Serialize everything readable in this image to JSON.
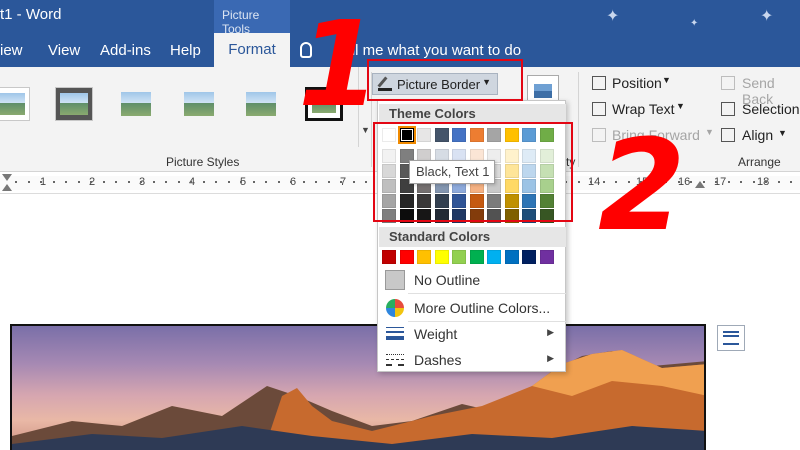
{
  "titlebar": {
    "doc_title": "t1 - Word",
    "context_tab": "Picture Tools"
  },
  "menu": {
    "view": "iew",
    "view2": "View",
    "addins": "Add-ins",
    "help": "Help",
    "format": "Format",
    "tellme": "Tell me what you want to do"
  },
  "ribbon": {
    "picture_styles_label": "Picture Styles",
    "picture_border_label": "Picture Border",
    "arrange_label": "Arrange",
    "position": "Position",
    "wrap_text": "Wrap Text",
    "bring_forward": "Bring Forward",
    "send_back": "Send Back",
    "selection": "Selection",
    "align": "Align",
    "size_fragment": "ty"
  },
  "ruler": {
    "numbers_left": [
      "1",
      "1",
      "2",
      "3",
      "4",
      "5",
      "6",
      "7",
      "8"
    ],
    "numbers_right": [
      "14",
      "15",
      "16",
      "17",
      "18"
    ]
  },
  "dropdown": {
    "theme_colors_header": "Theme Colors",
    "standard_colors_header": "Standard Colors",
    "tooltip": "Black, Text 1",
    "no_outline": "No Outline",
    "more_outline_colors": "More Outline Colors...",
    "weight": "Weight",
    "dashes": "Dashes",
    "theme_top_row": [
      "#ffffff",
      "#000000",
      "#e7e6e6",
      "#44546a",
      "#4472c4",
      "#ed7d31",
      "#a5a5a5",
      "#ffc000",
      "#5b9bd5",
      "#70ad47"
    ],
    "theme_shades": [
      [
        "#f2f2f2",
        "#7f7f7f",
        "#d0cece",
        "#d6dce4",
        "#d9e2f3",
        "#fbe5d5",
        "#ededed",
        "#fff2cc",
        "#deebf6",
        "#e2efd9"
      ],
      [
        "#d8d8d8",
        "#595959",
        "#aeabab",
        "#adb9ca",
        "#b4c6e7",
        "#f7cbac",
        "#dbdbdb",
        "#fee599",
        "#bdd7ee",
        "#c5e0b3"
      ],
      [
        "#bfbfbf",
        "#3f3f3f",
        "#757070",
        "#8496b0",
        "#8eaadb",
        "#f4b183",
        "#c9c9c9",
        "#ffd965",
        "#9cc3e5",
        "#a8d08d"
      ],
      [
        "#a5a5a5",
        "#262626",
        "#3a3838",
        "#323f4f",
        "#2f5496",
        "#c55a11",
        "#7b7b7b",
        "#bf9000",
        "#2e75b5",
        "#538135"
      ],
      [
        "#7f7f7f",
        "#0c0c0c",
        "#171616",
        "#222a35",
        "#1f3864",
        "#833c0b",
        "#525252",
        "#7f6000",
        "#1e4e79",
        "#375623"
      ]
    ],
    "standard": [
      "#c00000",
      "#ff0000",
      "#ffc000",
      "#ffff00",
      "#92d050",
      "#00b050",
      "#00b0f0",
      "#0070c0",
      "#002060",
      "#7030a0"
    ]
  },
  "annotations": {
    "step1": "1",
    "step2": "2",
    "color": "#ff0000"
  }
}
